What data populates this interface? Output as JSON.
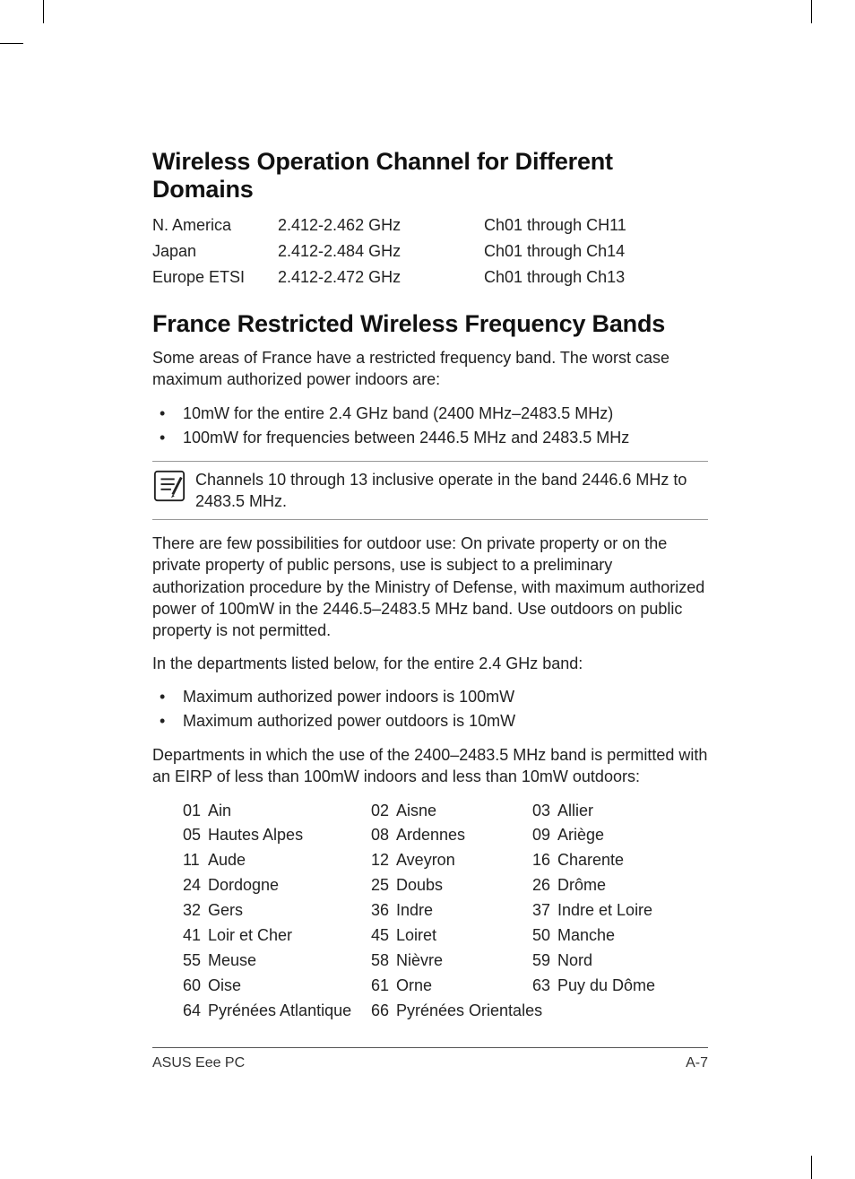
{
  "headings": {
    "wireless": "Wireless Operation Channel for Different Domains",
    "france": "France Restricted Wireless Frequency Bands"
  },
  "domain_table": [
    {
      "region": "N. America",
      "freq": "2.412-2.462 GHz",
      "channels": "Ch01 through CH11"
    },
    {
      "region": "Japan",
      "freq": "2.412-2.484 GHz",
      "channels": "Ch01 through Ch14"
    },
    {
      "region": "Europe ETSI",
      "freq": "2.412-2.472 GHz",
      "channels": "Ch01 through Ch13"
    }
  ],
  "france_intro": "Some areas of France have a restricted frequency band. The worst case maximum authorized power indoors are:",
  "france_bullets_1": [
    "10mW for the entire 2.4 GHz band (2400 MHz–2483.5 MHz)",
    "100mW for frequencies between 2446.5 MHz and 2483.5 MHz"
  ],
  "note": "Channels 10 through 13 inclusive operate in the band 2446.6 MHz to 2483.5 MHz.",
  "outdoor_para": "There are few possibilities for outdoor use: On private property or on the private property of public persons, use is subject to a preliminary authorization procedure by the Ministry of Defense, with maximum authorized power of 100mW in the 2446.5–2483.5 MHz band. Use outdoors on public property is not permitted.",
  "dept_intro": "In the departments listed below, for the entire 2.4 GHz band:",
  "dept_bullets": [
    "Maximum authorized power indoors is 100mW",
    "Maximum authorized power outdoors is 10mW"
  ],
  "dept_para": "Departments in which the use of the 2400–2483.5 MHz band is permitted with an EIRP of less than 100mW indoors and less than 10mW outdoors:",
  "departments": [
    [
      {
        "code": "01",
        "name": "Ain"
      },
      {
        "code": "02",
        "name": "Aisne"
      },
      {
        "code": "03",
        "name": "Allier"
      }
    ],
    [
      {
        "code": "05",
        "name": "Hautes Alpes"
      },
      {
        "code": "08",
        "name": "Ardennes"
      },
      {
        "code": "09",
        "name": "Ariège"
      }
    ],
    [
      {
        "code": "11",
        "name": "Aude"
      },
      {
        "code": "12",
        "name": "Aveyron"
      },
      {
        "code": "16",
        "name": "Charente"
      }
    ],
    [
      {
        "code": "24",
        "name": "Dordogne"
      },
      {
        "code": "25",
        "name": "Doubs"
      },
      {
        "code": "26",
        "name": "Drôme"
      }
    ],
    [
      {
        "code": "32",
        "name": "Gers"
      },
      {
        "code": "36",
        "name": "Indre"
      },
      {
        "code": "37",
        "name": "Indre et Loire"
      }
    ],
    [
      {
        "code": "41",
        "name": "Loir et Cher"
      },
      {
        "code": "45",
        "name": "Loiret"
      },
      {
        "code": "50",
        "name": "Manche"
      }
    ],
    [
      {
        "code": "55",
        "name": "Meuse"
      },
      {
        "code": "58",
        "name": "Nièvre"
      },
      {
        "code": "59",
        "name": "Nord"
      }
    ],
    [
      {
        "code": "60",
        "name": "Oise"
      },
      {
        "code": "61",
        "name": "Orne"
      },
      {
        "code": "63",
        "name": "Puy du Dôme"
      }
    ],
    [
      {
        "code": "64",
        "name": "Pyrénées Atlantique"
      },
      {
        "code": "66",
        "name": "Pyrénées Orientales"
      }
    ]
  ],
  "footer": {
    "left": "ASUS Eee PC",
    "right": "A-7"
  }
}
